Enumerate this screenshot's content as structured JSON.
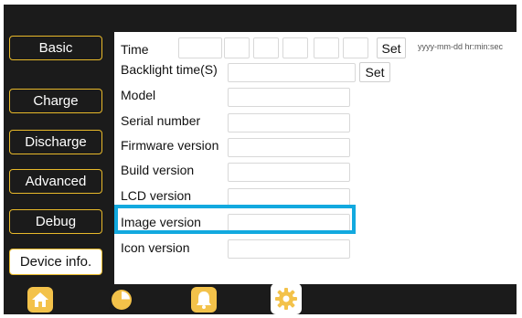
{
  "sidebar": {
    "items": [
      {
        "label": "Basic"
      },
      {
        "label": "Charge"
      },
      {
        "label": "Discharge"
      },
      {
        "label": "Advanced"
      },
      {
        "label": "Debug"
      },
      {
        "label": "Device info."
      }
    ],
    "active": "Device info."
  },
  "time_row": {
    "label": "Time",
    "set_label": "Set",
    "format_hint": "yyyy-mm-dd hr:min:sec",
    "fields": [
      "",
      "",
      "",
      "",
      "",
      "",
      ""
    ]
  },
  "backlight_row": {
    "label": "Backlight time(S)",
    "value": "",
    "set_label": "Set"
  },
  "info_rows": [
    {
      "label": "Model",
      "value": ""
    },
    {
      "label": "Serial number",
      "value": ""
    },
    {
      "label": "Firmware version",
      "value": ""
    },
    {
      "label": "Build version",
      "value": ""
    },
    {
      "label": "LCD version",
      "value": ""
    },
    {
      "label": "Image version",
      "value": ""
    },
    {
      "label": "Icon version",
      "value": ""
    }
  ],
  "highlighted_row": "LCD version",
  "bottom_nav": [
    {
      "icon": "home-icon",
      "bg": "#f3c24a"
    },
    {
      "icon": "pie-chart-icon",
      "bg": "#1b1b1b"
    },
    {
      "icon": "bell-icon",
      "bg": "#f3c24a"
    },
    {
      "icon": "gear-icon",
      "bg": "#ffffff",
      "active": true
    }
  ],
  "colors": {
    "background": "#1b1b1b",
    "accent": "#e8b92a",
    "highlight": "#12a9df"
  }
}
